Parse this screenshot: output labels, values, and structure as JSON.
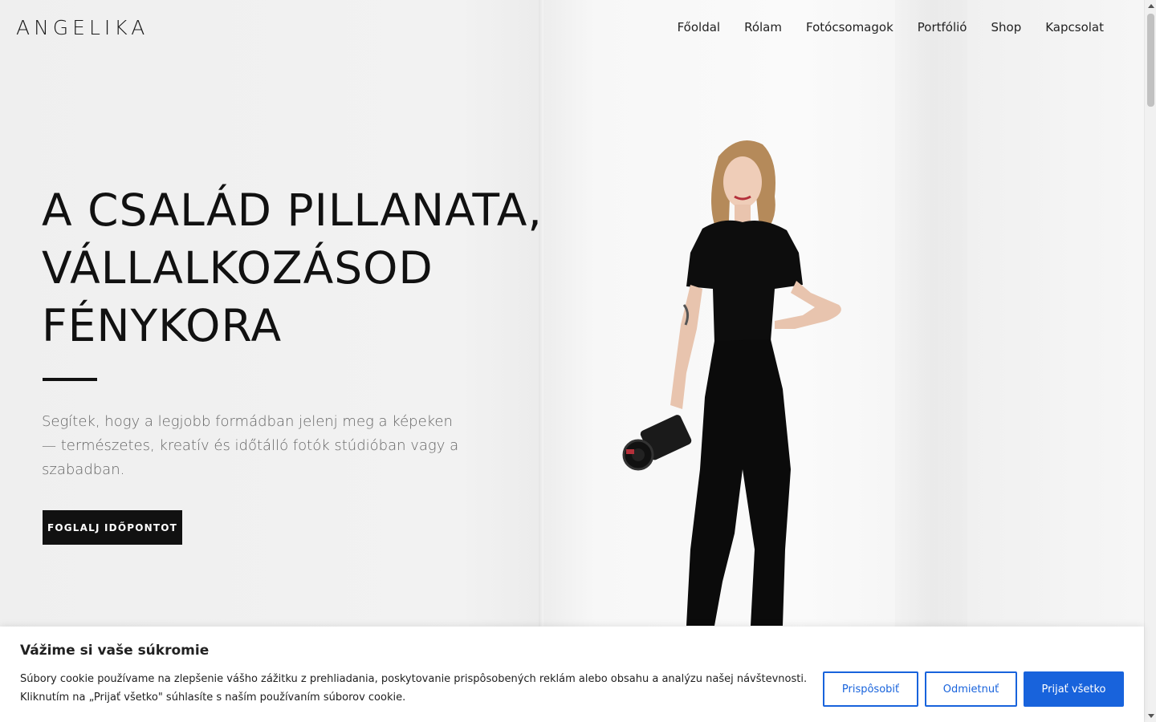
{
  "header": {
    "logo": "ANGELIKA",
    "nav": [
      {
        "label": "Főoldal"
      },
      {
        "label": "Rólam"
      },
      {
        "label": "Fotócsomagok"
      },
      {
        "label": "Portfólió"
      },
      {
        "label": "Shop"
      },
      {
        "label": "Kapcsolat"
      }
    ]
  },
  "hero": {
    "headline_lines": [
      "A CSALÁD PILLANATA,",
      "VÁLLALKOZÁSOD",
      "FÉNYKORA"
    ],
    "subtext": "Segítek, hogy a legjobb formádban jelenj meg a képeken — természetes, kreatív és időtálló fotók stúdióban vagy a szabadban.",
    "cta_label": "FOGLALJ IDŐPONTOT"
  },
  "cookie_banner": {
    "title": "Vážime si vaše súkromie",
    "text": "Súbory cookie používame na zlepšenie vášho zážitku z prehliadania, poskytovanie prispôsobených reklám alebo obsahu a analýzu našej návštevnosti. Kliknutím na „Prijať všetko\" súhlasíte s naším používaním súborov cookie.",
    "customize_label": "Prispôsobiť",
    "reject_label": "Odmietnuť",
    "accept_label": "Prijať všetko"
  },
  "colors": {
    "accent": "#1863dc",
    "text_dark": "#111111",
    "cta_bg": "#111111"
  },
  "icons": [
    "scroll-up-arrow-icon",
    "scroll-down-arrow-icon"
  ]
}
